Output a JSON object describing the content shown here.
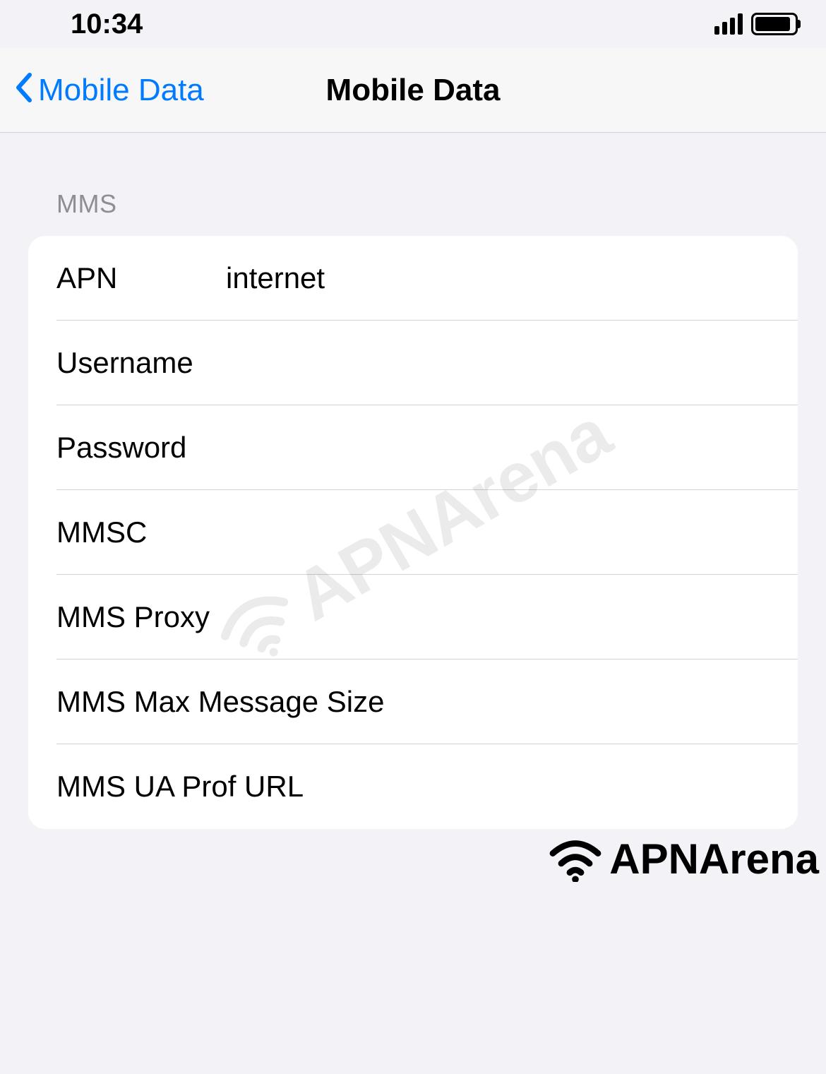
{
  "statusBar": {
    "time": "10:34"
  },
  "navBar": {
    "backLabel": "Mobile Data",
    "title": "Mobile Data"
  },
  "section": {
    "header": "MMS",
    "rows": {
      "apn": {
        "label": "APN",
        "value": "internet"
      },
      "username": {
        "label": "Username",
        "value": ""
      },
      "password": {
        "label": "Password",
        "value": ""
      },
      "mmsc": {
        "label": "MMSC",
        "value": ""
      },
      "mmsProxy": {
        "label": "MMS Proxy",
        "value": ""
      },
      "mmsMaxSize": {
        "label": "MMS Max Message Size",
        "value": ""
      },
      "mmsUaProf": {
        "label": "MMS UA Prof URL",
        "value": ""
      }
    }
  },
  "watermark": {
    "text": "APNArena"
  },
  "brand": {
    "text": "APNArena"
  }
}
